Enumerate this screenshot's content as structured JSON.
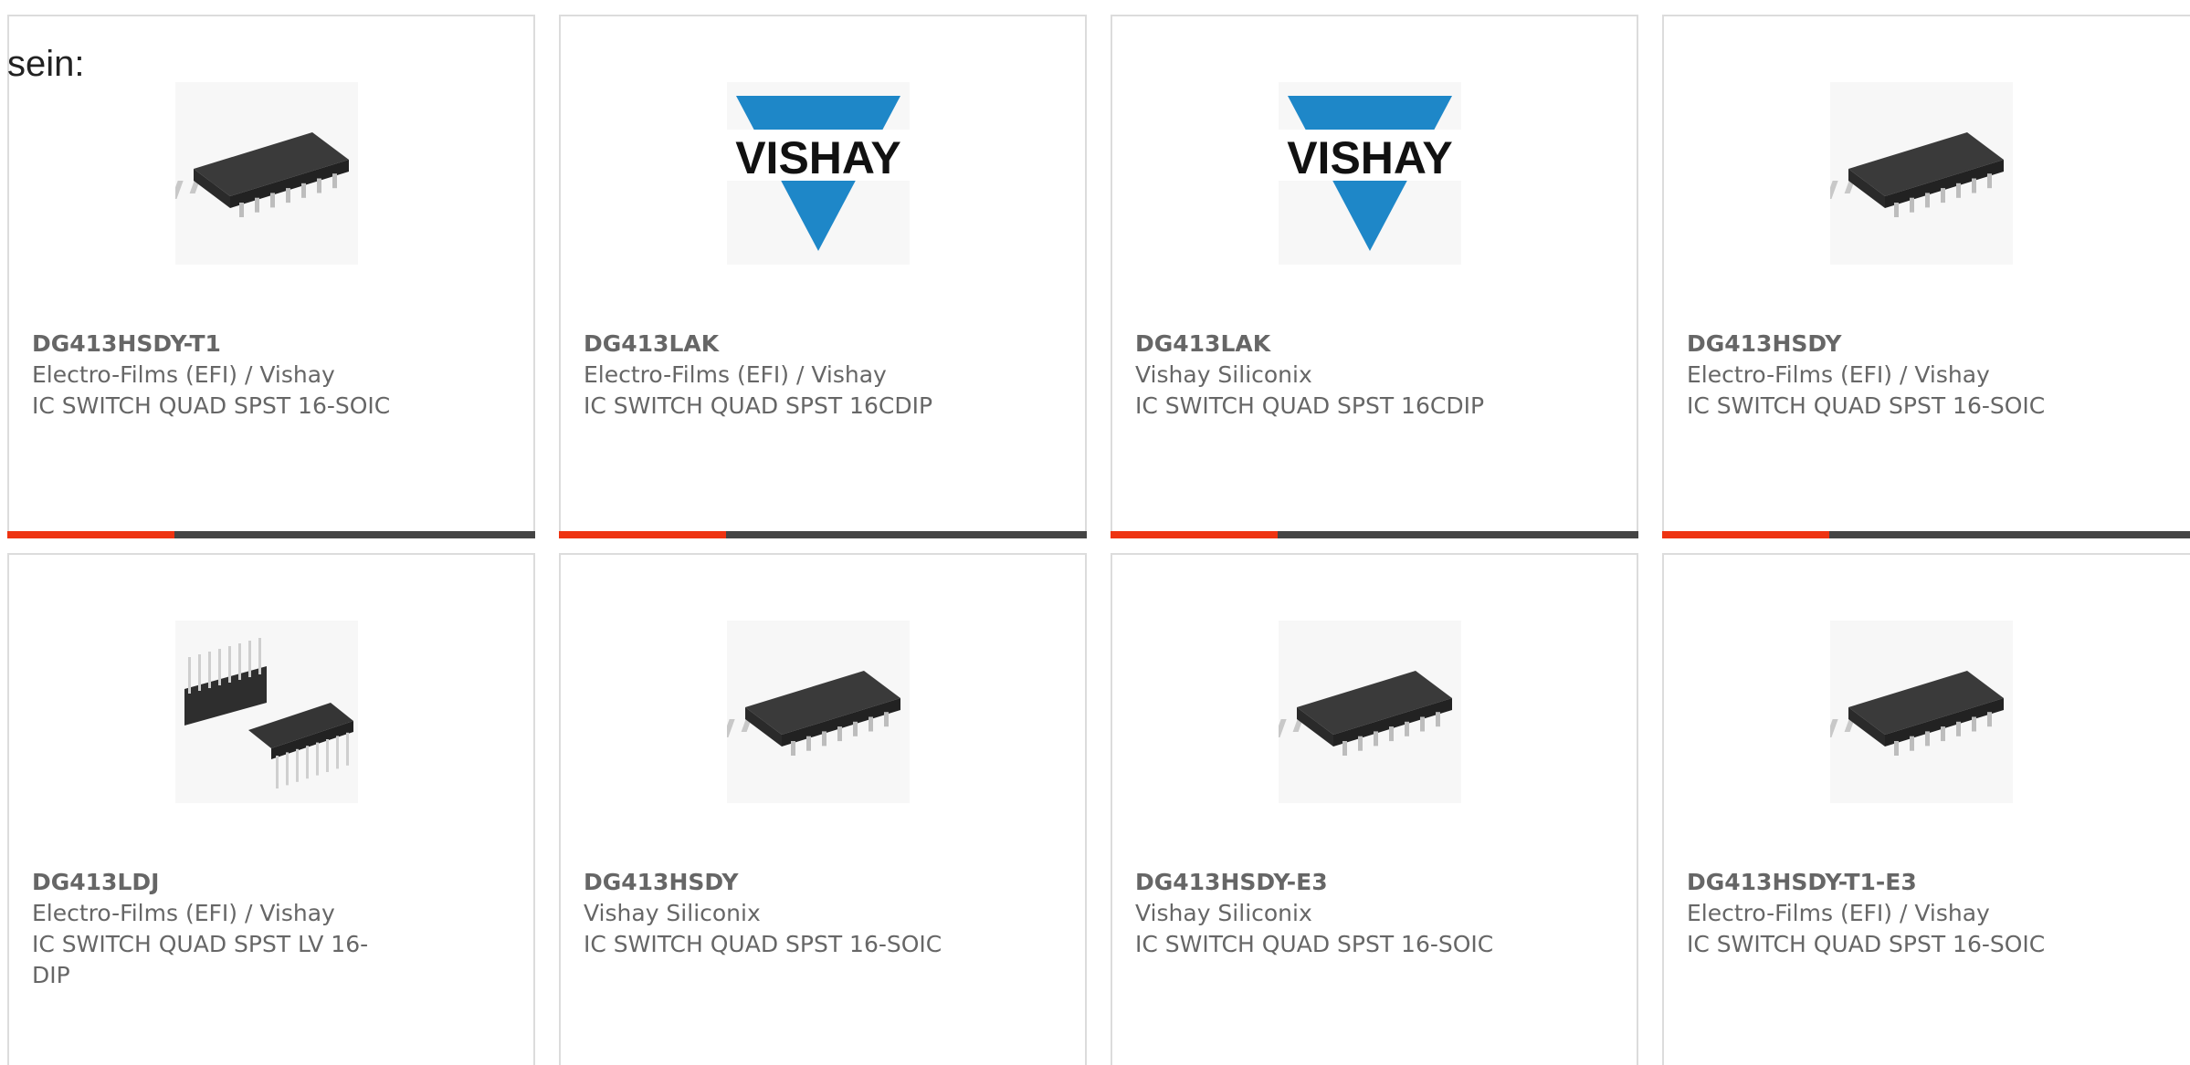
{
  "intro_text": "sein:",
  "colors": {
    "accent": "#ee3311",
    "bar": "#444444",
    "text": "#666666",
    "border": "#dcdcdc",
    "vishay_blue": "#1e87c8"
  },
  "products": [
    {
      "part": "DG413HSDY-T1",
      "manufacturer": "Electro-Films (EFI) / Vishay",
      "description": "IC SWITCH QUAD SPST 16-SOIC",
      "image": "soic-16-chip-icon"
    },
    {
      "part": "DG413LAK",
      "manufacturer": "Electro-Films (EFI) / Vishay",
      "description": "IC SWITCH QUAD SPST 16CDIP",
      "image": "vishay-logo"
    },
    {
      "part": "DG413LAK",
      "manufacturer": "Vishay Siliconix",
      "description": "IC SWITCH QUAD SPST 16CDIP",
      "image": "vishay-logo"
    },
    {
      "part": "DG413HSDY",
      "manufacturer": "Electro-Films (EFI) / Vishay",
      "description": "IC SWITCH QUAD SPST 16-SOIC",
      "image": "soic-16-chip-icon"
    },
    {
      "part": "DG413LDJ",
      "manufacturer": "Electro-Films (EFI) / Vishay",
      "description": "IC SWITCH QUAD SPST LV 16-DIP",
      "image": "dip-16-chip-icon"
    },
    {
      "part": "DG413HSDY",
      "manufacturer": "Vishay Siliconix",
      "description": "IC SWITCH QUAD SPST 16-SOIC",
      "image": "soic-16-chip-icon"
    },
    {
      "part": "DG413HSDY-E3",
      "manufacturer": "Vishay Siliconix",
      "description": "IC SWITCH QUAD SPST 16-SOIC",
      "image": "soic-16-chip-icon"
    },
    {
      "part": "DG413HSDY-T1-E3",
      "manufacturer": "Electro-Films (EFI) / Vishay",
      "description": "IC SWITCH QUAD SPST 16-SOIC",
      "image": "soic-16-chip-icon"
    }
  ]
}
